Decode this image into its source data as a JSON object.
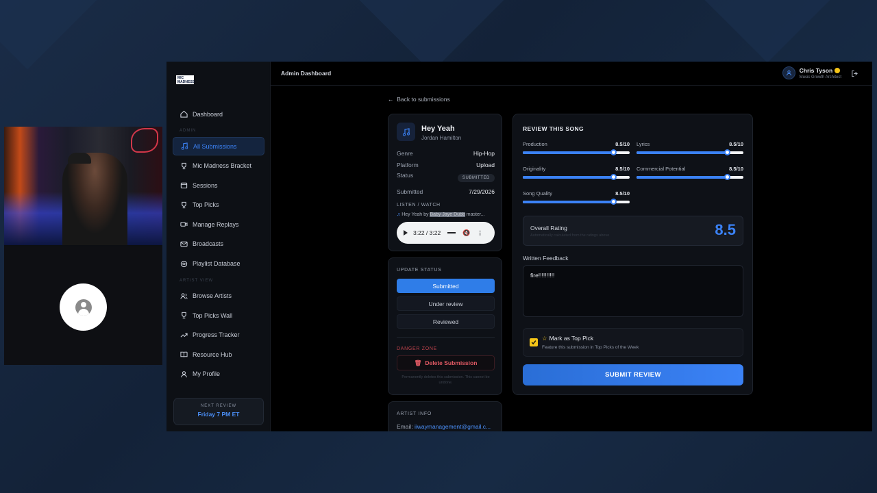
{
  "app": {
    "logo_line1": "MIC",
    "logo_line2": "MADNESS",
    "topbar_title": "Admin Dashboard"
  },
  "user": {
    "name": "Chris Tyson",
    "role": "Music Growth Architect"
  },
  "sidebar": {
    "dashboard": "Dashboard",
    "admin_section": "ADMIN",
    "admin_items": [
      "All Submissions",
      "Mic Madness Bracket",
      "Sessions",
      "Top Picks",
      "Manage Replays",
      "Broadcasts",
      "Playlist Database"
    ],
    "artist_section": "ARTIST VIEW",
    "artist_items": [
      "Browse Artists",
      "Top Picks Wall",
      "Progress Tracker",
      "Resource Hub",
      "My Profile"
    ],
    "next_review_label": "NEXT REVIEW",
    "next_review_value": "Friday 7 PM ET"
  },
  "back_link": "Back to submissions",
  "song": {
    "title": "Hey Yeah",
    "artist": "Jordan Hamilton",
    "genre_label": "Genre",
    "genre": "Hip-Hop",
    "platform_label": "Platform",
    "platform": "Upload",
    "status_label": "Status",
    "status": "SUBMITTED",
    "submitted_label": "Submitted",
    "submitted": "7/29/2026",
    "listen_label": "LISTEN / WATCH",
    "file_prefix": "Hey Yeah by ",
    "file_highlight": "Baby Jaye Dubb",
    "file_suffix": " master...",
    "player_time": "3:22 / 3:22"
  },
  "update_status": {
    "label": "UPDATE STATUS",
    "options": [
      "Submitted",
      "Under review",
      "Reviewed"
    ],
    "selected": "Submitted",
    "danger_label": "DANGER ZONE",
    "delete_label": "Delete Submission",
    "delete_note": "Permanently deletes this submission. This cannot be undone."
  },
  "artist_info": {
    "label": "ARTIST INFO",
    "email_label": "Email:",
    "email": "iiwaymanagement@gmail.c..."
  },
  "review": {
    "title": "REVIEW THIS SONG",
    "scores": [
      {
        "label": "Production",
        "value": "8.5/10",
        "fraction": 0.85
      },
      {
        "label": "Lyrics",
        "value": "8.5/10",
        "fraction": 0.85
      },
      {
        "label": "Originality",
        "value": "8.5/10",
        "fraction": 0.85
      },
      {
        "label": "Commercial Potential",
        "value": "8.5/10",
        "fraction": 0.85
      },
      {
        "label": "Song Quality",
        "value": "8.5/10",
        "fraction": 0.85
      }
    ],
    "overall_label": "Overall Rating",
    "overall_hint": "Automatically calculated from the ratings above",
    "overall_value": "8.5",
    "feedback_label": "Written Feedback",
    "feedback_value": "fire!!!!!!!!!!",
    "toppick_label": "Mark as Top Pick",
    "toppick_desc": "Feature this submission in Top Picks of the Week",
    "submit_label": "SUBMIT REVIEW"
  },
  "colors": {
    "accent": "#3b82f6",
    "danger": "#e25a64",
    "star": "#f5c518"
  }
}
